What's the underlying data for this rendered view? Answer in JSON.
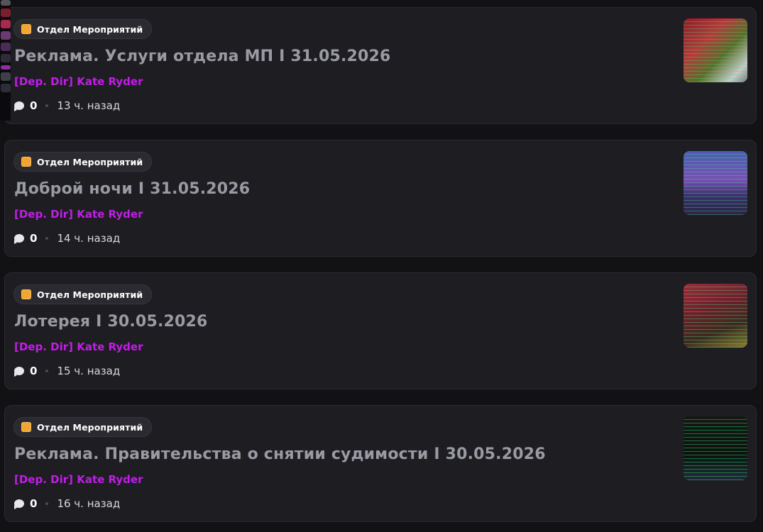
{
  "posts": [
    {
      "category": "Отдел Мероприятий",
      "title": "Реклама. Услуги отдела МП I 31.05.2026",
      "author": "[Dep. Dir] Kate Ryder",
      "comments": "0",
      "time": "13 ч. назад"
    },
    {
      "category": "Отдел Мероприятий",
      "title": "Доброй ночи I 31.05.2026",
      "author": "[Dep. Dir] Kate Ryder",
      "comments": "0",
      "time": "14 ч. назад"
    },
    {
      "category": "Отдел Мероприятий",
      "title": "Лотерея I 30.05.2026",
      "author": "[Dep. Dir] Kate Ryder",
      "comments": "0",
      "time": "15 ч. назад"
    },
    {
      "category": "Отдел Мероприятий",
      "title": "Реклама. Правительства о снятии судимости I 30.05.2026",
      "author": "[Dep. Dir] Kate Ryder",
      "comments": "0",
      "time": "16 ч. назад"
    }
  ],
  "colors": {
    "background": "#121215",
    "card": "#1d1d22",
    "author": "#c21ee6",
    "category_icon": "#f2a531",
    "title": "#9a9aa2"
  },
  "icons": {
    "category": "orange-square-icon",
    "comments": "speech-bubble-icon"
  }
}
